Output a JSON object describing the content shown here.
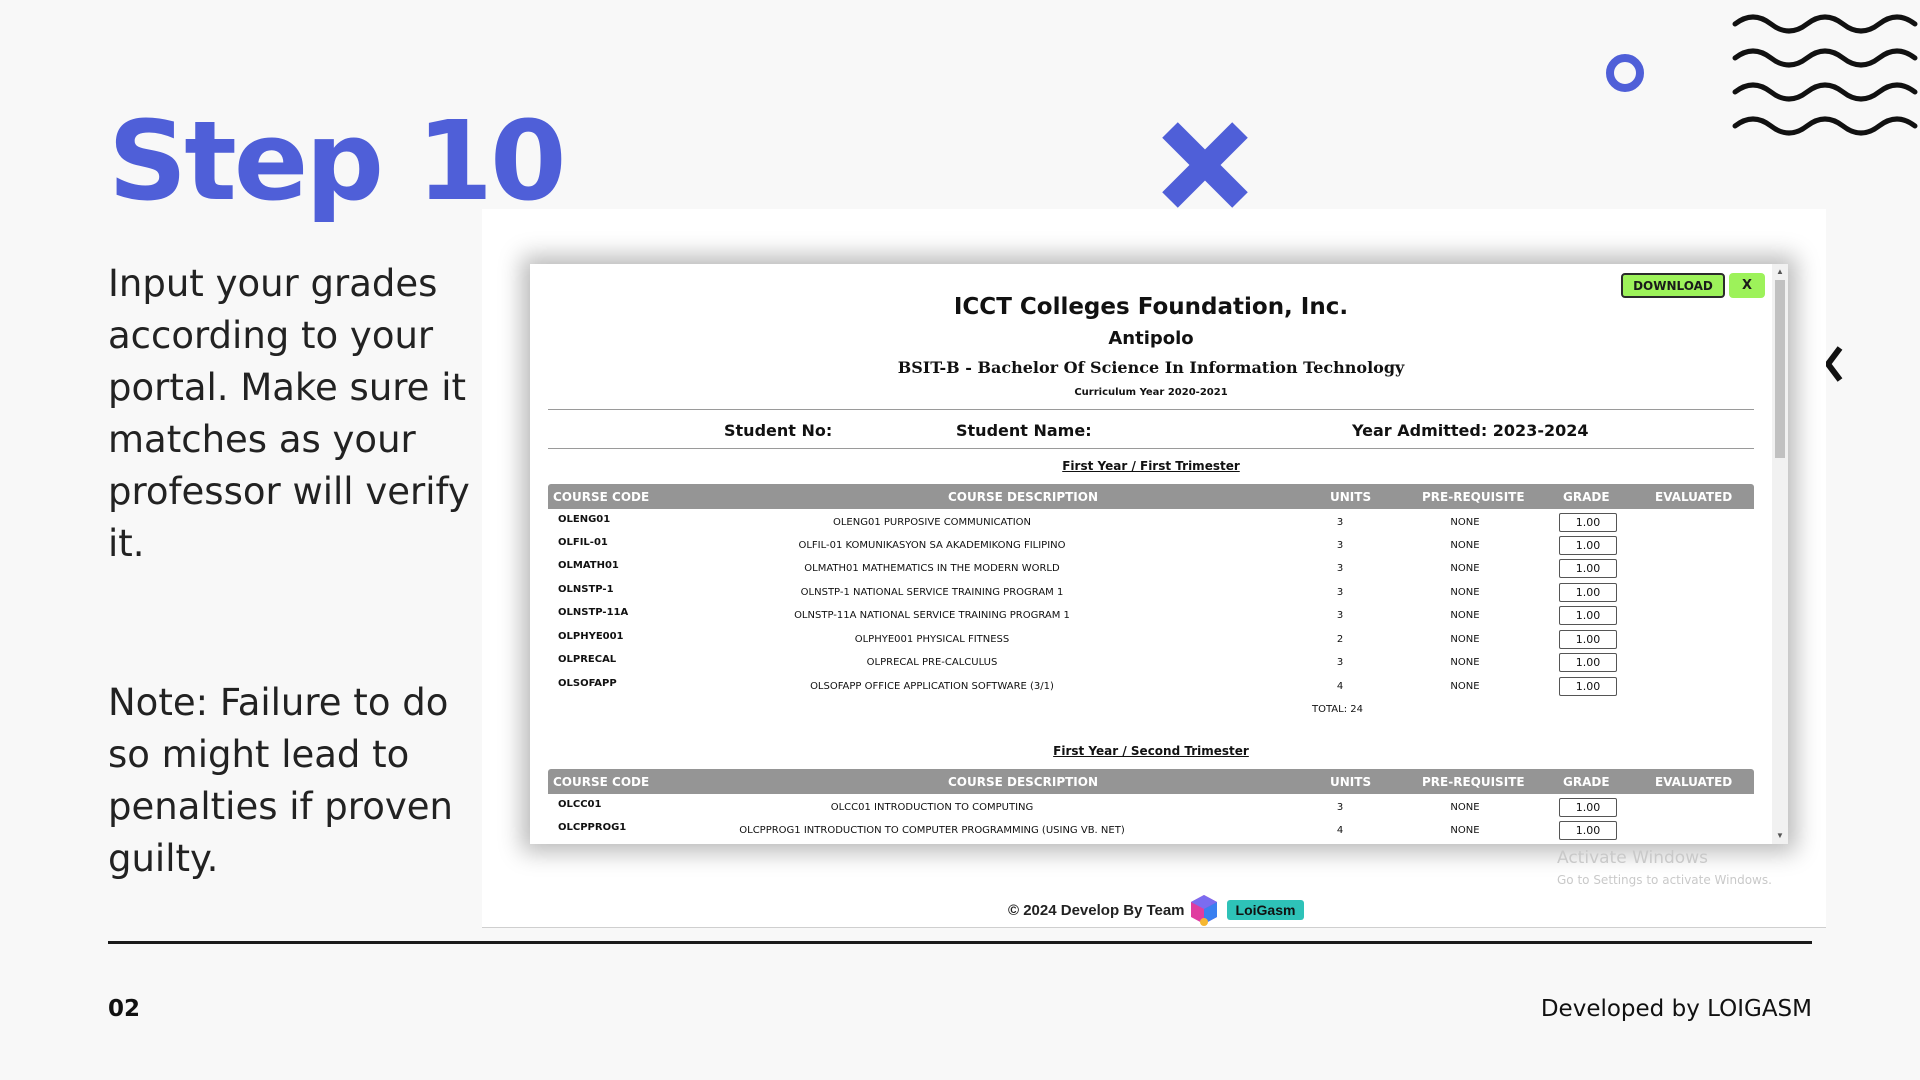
{
  "slide": {
    "title": "Step 10",
    "instructions": "Input your grades according to your portal. Make sure it matches as your professor will verify it.",
    "note": "Note: Failure to do so might lead to penalties if proven guilty.",
    "page_number": "02",
    "developed_by": "Developed by LOIGASM",
    "accent_color": "#4f5fd8"
  },
  "modal": {
    "download_label": "DOWNLOAD",
    "close_label": "X",
    "school_name": "ICCT Colleges Foundation, Inc.",
    "campus": "Antipolo",
    "program": "BSIT-B - Bachelor Of Science In Information Technology",
    "curriculum": "Curriculum Year 2020-2021",
    "student_no_label": "Student No:",
    "student_name_label": "Student Name:",
    "year_admitted": "Year Admitted: 2023-2024",
    "columns": {
      "code": "COURSE CODE",
      "description": "COURSE DESCRIPTION",
      "units": "UNITS",
      "prereq": "PRE-REQUISITE",
      "grade": "GRADE",
      "evaluated": "EVALUATED"
    },
    "semesters": [
      {
        "title": "First Year / First Trimester",
        "total": "TOTAL: 24",
        "courses": [
          {
            "code": "OLENG01",
            "description": "OLENG01 PURPOSIVE COMMUNICATION",
            "units": "3",
            "prereq": "NONE",
            "grade": "1.00"
          },
          {
            "code": "OLFIL-01",
            "description": "OLFIL-01 KOMUNIKASYON SA AKADEMIKONG FILIPINO",
            "units": "3",
            "prereq": "NONE",
            "grade": "1.00"
          },
          {
            "code": "OLMATH01",
            "description": "OLMATH01 MATHEMATICS IN THE MODERN WORLD",
            "units": "3",
            "prereq": "NONE",
            "grade": "1.00"
          },
          {
            "code": "OLNSTP-1",
            "description": "OLNSTP-1 NATIONAL SERVICE TRAINING PROGRAM 1",
            "units": "3",
            "prereq": "NONE",
            "grade": "1.00"
          },
          {
            "code": "OLNSTP-11A",
            "description": "OLNSTP-11A NATIONAL SERVICE TRAINING PROGRAM 1",
            "units": "3",
            "prereq": "NONE",
            "grade": "1.00"
          },
          {
            "code": "OLPHYE001",
            "description": "OLPHYE001 PHYSICAL FITNESS",
            "units": "2",
            "prereq": "NONE",
            "grade": "1.00"
          },
          {
            "code": "OLPRECAL",
            "description": "OLPRECAL PRE-CALCULUS",
            "units": "3",
            "prereq": "NONE",
            "grade": "1.00"
          },
          {
            "code": "OLSOFAPP",
            "description": "OLSOFAPP OFFICE APPLICATION SOFTWARE (3/1)",
            "units": "4",
            "prereq": "NONE",
            "grade": "1.00"
          }
        ]
      },
      {
        "title": "First Year / Second Trimester",
        "courses": [
          {
            "code": "OLCC01",
            "description": "OLCC01 INTRODUCTION TO COMPUTING",
            "units": "3",
            "prereq": "NONE",
            "grade": "1.00"
          },
          {
            "code": "OLCPPROG1",
            "description": "OLCPPROG1 INTRODUCTION TO COMPUTER PROGRAMMING (USING VB. NET)",
            "units": "4",
            "prereq": "NONE",
            "grade": "1.00"
          }
        ]
      }
    ]
  },
  "watermark": {
    "title": "Activate Windows",
    "subtitle": "Go to Settings to activate Windows."
  },
  "footer": {
    "credit": "© 2024 Develop By",
    "team_label": "Team",
    "team_name": "LoiGasm"
  },
  "icons": [
    "x-shape-icon",
    "ring-icon",
    "wave-lines-icon",
    "chevron-left-icon",
    "team-logo-icon"
  ]
}
